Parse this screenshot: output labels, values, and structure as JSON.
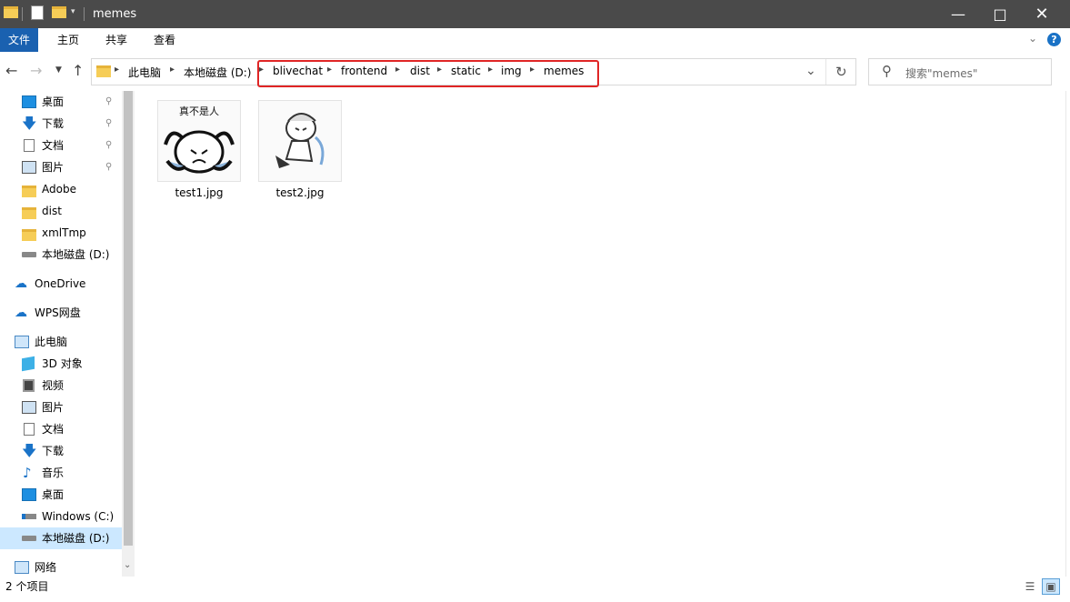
{
  "window": {
    "title": "memes"
  },
  "ribbon": {
    "tabs": [
      "文件",
      "主页",
      "共享",
      "查看"
    ]
  },
  "navigation": {
    "path": [
      "此电脑",
      "本地磁盘 (D:)",
      "blivechat",
      "frontend",
      "dist",
      "static",
      "img",
      "memes"
    ],
    "search_placeholder": "搜索\"memes\""
  },
  "sidebar": {
    "quick_access": [
      {
        "label": "桌面",
        "icon": "desktop-icon",
        "pinned": true
      },
      {
        "label": "下载",
        "icon": "download-icon",
        "pinned": true
      },
      {
        "label": "文档",
        "icon": "document-icon",
        "pinned": true
      },
      {
        "label": "图片",
        "icon": "picture-icon",
        "pinned": true
      },
      {
        "label": "Adobe",
        "icon": "folder-icon",
        "pinned": false
      },
      {
        "label": "dist",
        "icon": "folder-icon",
        "pinned": false
      },
      {
        "label": "xmlTmp",
        "icon": "folder-icon",
        "pinned": false
      },
      {
        "label": "本地磁盘 (D:)",
        "icon": "drive-icon",
        "pinned": false
      }
    ],
    "onedrive": "OneDrive",
    "wps": "WPS网盘",
    "this_pc": "此电脑",
    "pc_items": [
      {
        "label": "3D 对象",
        "icon": "cube-icon"
      },
      {
        "label": "视频",
        "icon": "video-icon"
      },
      {
        "label": "图片",
        "icon": "picture-icon"
      },
      {
        "label": "文档",
        "icon": "document-icon"
      },
      {
        "label": "下载",
        "icon": "download-icon"
      },
      {
        "label": "音乐",
        "icon": "music-icon"
      },
      {
        "label": "桌面",
        "icon": "desktop-icon"
      },
      {
        "label": "Windows (C:)",
        "icon": "drive-icon"
      },
      {
        "label": "本地磁盘 (D:)",
        "icon": "drive-icon"
      }
    ],
    "network": "网络"
  },
  "files": [
    {
      "name": "test1.jpg",
      "caption": "真不是人"
    },
    {
      "name": "test2.jpg"
    }
  ],
  "status": {
    "item_count": "2 个项目"
  },
  "colors": {
    "accent": "#1a61b0",
    "highlight_box": "#e02525",
    "selected": "#cce8ff"
  }
}
